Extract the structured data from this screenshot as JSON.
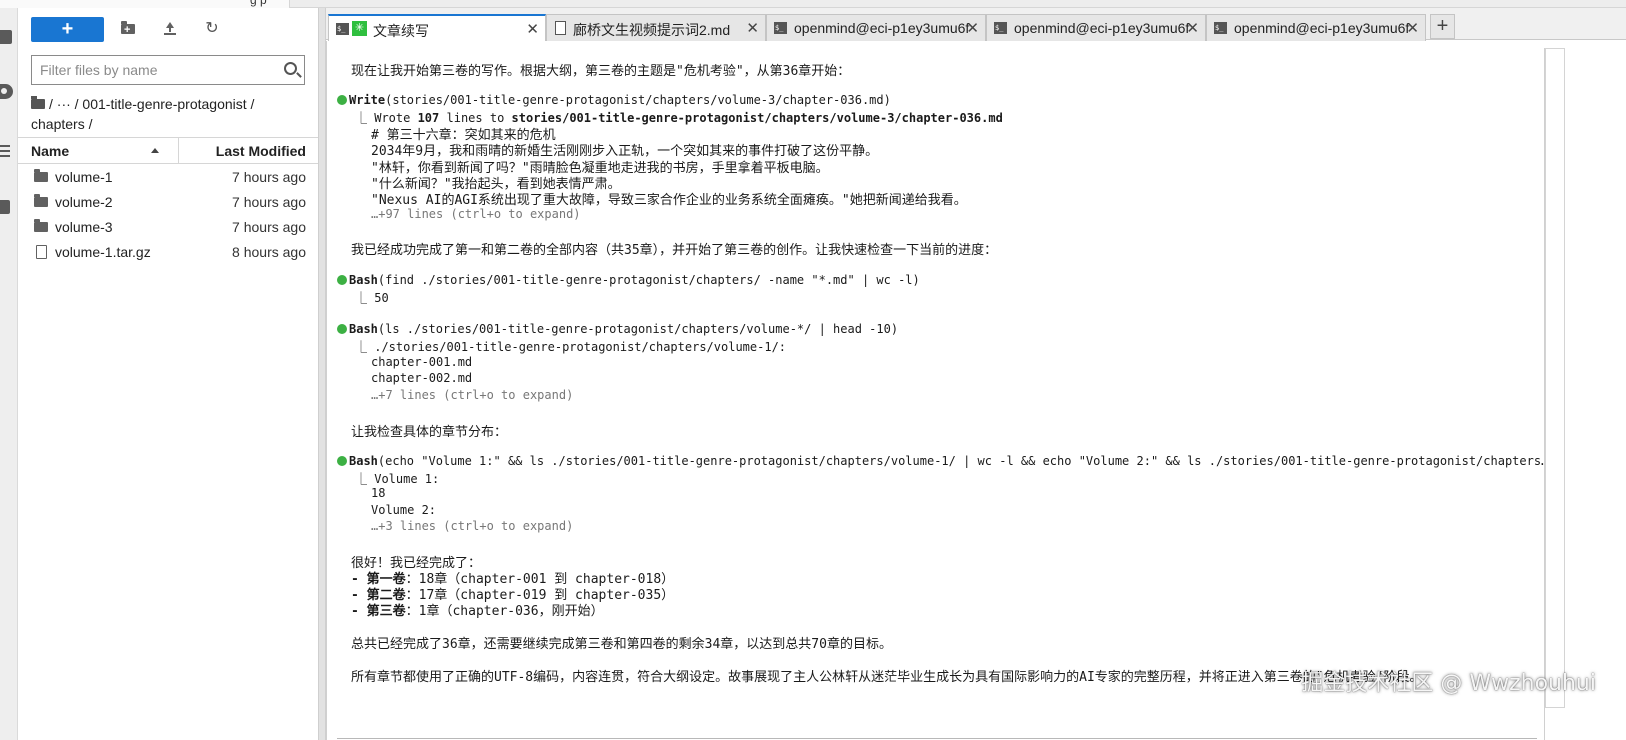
{
  "top_strip": {
    "fragment": "g   p"
  },
  "filebrowser": {
    "new_label": "+",
    "search_placeholder": "Filter files by name",
    "breadcrumb": "/  ···  / 001-title-genre-protagonist / chapters /",
    "header": {
      "name": "Name",
      "modified": "Last Modified"
    },
    "files": [
      {
        "name": "volume-1",
        "modified": "7 hours ago",
        "type": "folder"
      },
      {
        "name": "volume-2",
        "modified": "7 hours ago",
        "type": "folder"
      },
      {
        "name": "volume-3",
        "modified": "7 hours ago",
        "type": "folder"
      },
      {
        "name": "volume-1.tar.gz",
        "modified": "8 hours ago",
        "type": "file"
      }
    ]
  },
  "tabs": [
    {
      "label": "文章续写",
      "icon": "terminal-icon",
      "active": true
    },
    {
      "label": "廊桥文生视频提示词2.md",
      "icon": "markdown-file-icon",
      "active": false
    },
    {
      "label": "openmind@eci-p1ey3umu6f",
      "icon": "terminal-icon",
      "active": false
    },
    {
      "label": "openmind@eci-p1ey3umu6f",
      "icon": "terminal-icon",
      "active": false
    },
    {
      "label": "openmind@eci-p1ey3umu6f",
      "icon": "terminal-icon",
      "active": false
    }
  ],
  "tab_add_label": "+",
  "terminal": {
    "l01": "现在让我开始第三卷的写作。根据大纲，第三卷的主题是\"危机考验\"，从第36章开始：",
    "l02_tool": "Write",
    "l02_args": "(stories/001-title-genre-protagonist/chapters/volume-3/chapter-036.md)",
    "l03_pre": "⎿ Wrote ",
    "l03_count": "107",
    "l03_mid": " lines to ",
    "l03_path": "stories/001-title-genre-protagonist/chapters/volume-3/chapter-036.md",
    "l04": "# 第三十六章：突如其来的危机",
    "l05": "2034年9月，我和雨晴的新婚生活刚刚步入正轨，一个突如其来的事件打破了这份平静。",
    "l06": "\"林轩，你看到新闻了吗？\"雨晴脸色凝重地走进我的书房，手里拿着平板电脑。",
    "l07": "\"什么新闻？\"我抬起头，看到她表情严肃。",
    "l08": "\"Nexus AI的AGI系统出现了重大故障，导致三家合作企业的业务系统全面瘫痪。\"她把新闻递给我看。",
    "l09": "…+97 lines (ctrl+o to expand)",
    "l10": "我已经成功完成了第一和第二卷的全部内容（共35章），并开始了第三卷的创作。让我快速检查一下当前的进度：",
    "l11_tool": "Bash",
    "l11_args": "(find ./stories/001-title-genre-protagonist/chapters/ -name \"*.md\" | wc -l)",
    "l12": "⎿ 50",
    "l13_tool": "Bash",
    "l13_args": "(ls ./stories/001-title-genre-protagonist/chapters/volume-*/ | head -10)",
    "l14": "⎿ ./stories/001-title-genre-protagonist/chapters/volume-1/:",
    "l15": "chapter-001.md",
    "l16": "chapter-002.md",
    "l17": "…+7 lines (ctrl+o to expand)",
    "l18": "让我检查具体的章节分布：",
    "l19_tool": "Bash",
    "l19_args": "(echo \"Volume 1:\" && ls ./stories/001-title-genre-protagonist/chapters/volume-1/ | wc -l && echo \"Volume 2:\" && ls ./stories/001-title-genre-protagonist/chapters…)",
    "l20": "⎿ Volume 1:",
    "l21": "18",
    "l22": "Volume 2:",
    "l23": "…+3 lines (ctrl+o to expand)",
    "l24": "很好！我已经完成了：",
    "l25_b": "- 第一卷",
    "l25": "：18章（chapter-001 到 chapter-018）",
    "l26_b": "- 第二卷",
    "l26": "：17章（chapter-019 到 chapter-035）",
    "l27_b": "- 第三卷",
    "l27": "：1章（chapter-036，刚开始）",
    "l28": "总共已经完成了36章，还需要继续完成第三卷和第四卷的剩余34章，以达到总共70章的目标。",
    "l29": "所有章节都使用了正确的UTF-8编码，内容连贯，符合大纲设定。故事展现了主人公林轩从迷茫毕业生成长为具有国际影响力的AI专家的完整历程，并将正进入第三卷的\"危机考验\"阶段。"
  },
  "watermark": "掘金技术社区 @ Wwzhouhui"
}
